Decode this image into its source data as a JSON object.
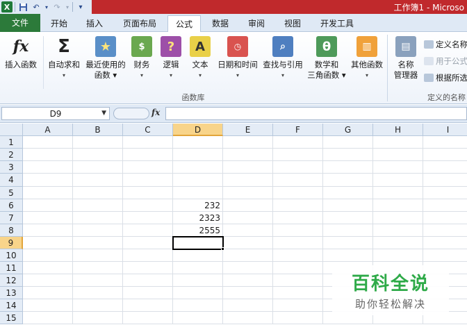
{
  "window": {
    "title": "工作簿1 - Microso"
  },
  "quick_access": [
    "excel-logo-icon",
    "save-icon",
    "undo-icon",
    "redo-icon",
    "customize-icon"
  ],
  "tabs": [
    {
      "label": "文件"
    },
    {
      "label": "开始"
    },
    {
      "label": "插入"
    },
    {
      "label": "页面布局"
    },
    {
      "label": "公式",
      "active": true
    },
    {
      "label": "数据"
    },
    {
      "label": "审阅"
    },
    {
      "label": "视图"
    },
    {
      "label": "开发工具"
    }
  ],
  "ribbon": {
    "group_label": "函数库",
    "group2_label": "定义的名称",
    "buttons": [
      {
        "line1": "插入函数",
        "line2": "",
        "icon": "fx-icon"
      },
      {
        "line1": "自动求和",
        "line2": "▾",
        "icon": "sigma-icon"
      },
      {
        "line1": "最近使用的",
        "line2": "函数 ▾",
        "icon": "recent-book-icon"
      },
      {
        "line1": "财务",
        "line2": "▾",
        "icon": "finance-book-icon"
      },
      {
        "line1": "逻辑",
        "line2": "▾",
        "icon": "logic-book-icon"
      },
      {
        "line1": "文本",
        "line2": "▾",
        "icon": "text-book-icon"
      },
      {
        "line1": "日期和时间",
        "line2": "▾",
        "icon": "datetime-book-icon"
      },
      {
        "line1": "查找与引用",
        "line2": "▾",
        "icon": "lookup-book-icon"
      },
      {
        "line1": "数学和",
        "line2": "三角函数 ▾",
        "icon": "math-book-icon"
      },
      {
        "line1": "其他函数",
        "line2": "▾",
        "icon": "more-books-icon"
      },
      {
        "line1": "名称",
        "line2": "管理器",
        "icon": "name-manager-icon"
      }
    ],
    "side_items": [
      {
        "label": "定义名称"
      },
      {
        "label": "用于公式"
      },
      {
        "label": "根据所选"
      }
    ]
  },
  "formula_bar": {
    "name_box": "D9",
    "fx_label": "fx",
    "formula": ""
  },
  "sheet": {
    "columns": [
      "A",
      "B",
      "C",
      "D",
      "E",
      "F",
      "G",
      "H",
      "I"
    ],
    "active_column": "D",
    "rows": [
      "1",
      "2",
      "3",
      "4",
      "5",
      "6",
      "7",
      "8",
      "9",
      "10",
      "11",
      "12",
      "13",
      "14",
      "15"
    ],
    "active_row": "9",
    "cells": [
      {
        "ref": "D6",
        "value": "232"
      },
      {
        "ref": "D7",
        "value": "2323"
      },
      {
        "ref": "D8",
        "value": "2555"
      }
    ]
  },
  "watermark": {
    "title": "百科全说",
    "subtitle": "助你轻松解决"
  },
  "colors": {
    "title_bar": "#c0292c",
    "file_tab": "#2c7a3a",
    "header_bg": "#e4ecf6",
    "active_header": "#f8d48a",
    "watermark_green": "#2eaa48"
  }
}
